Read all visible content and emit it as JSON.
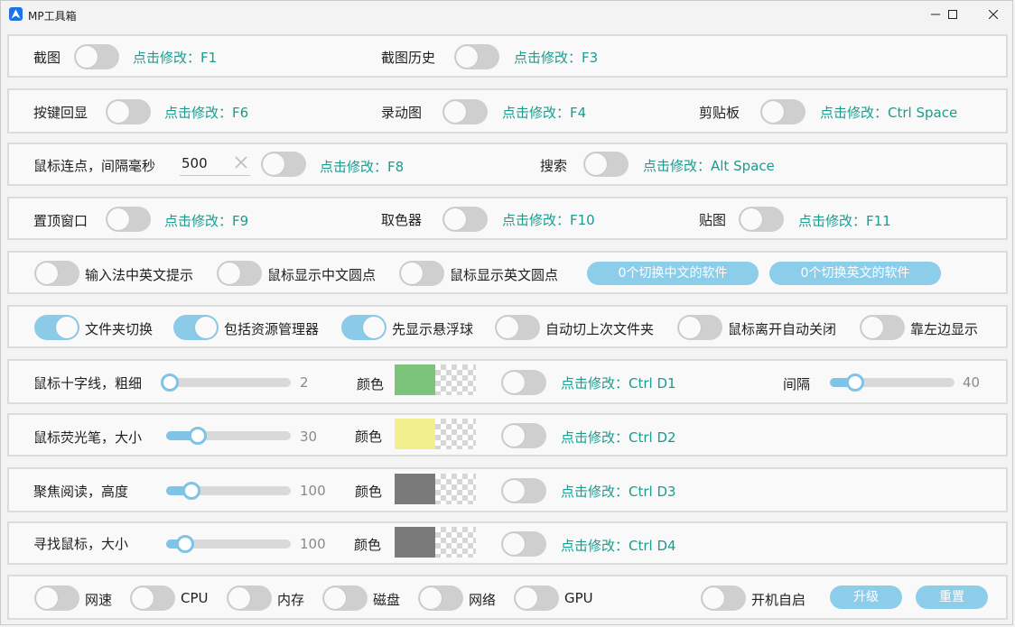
{
  "window": {
    "title": "MP工具箱"
  },
  "row1": {
    "screenshot": "截图",
    "screenshot_key": "点击修改：F1",
    "history": "截图历史",
    "history_key": "点击修改：F3"
  },
  "row2": {
    "keyecho": "按键回显",
    "keyecho_key": "点击修改：F6",
    "gif": "录动图",
    "gif_key": "点击修改：F4",
    "clipboard": "剪贴板",
    "clipboard_key": "点击修改：Ctrl Space"
  },
  "row3": {
    "autoclick": "鼠标连点，间隔毫秒",
    "interval": "500",
    "autoclick_key": "点击修改：F8",
    "search": "搜索",
    "search_key": "点击修改：Alt Space"
  },
  "row4": {
    "pin": "置顶窗口",
    "pin_key": "点击修改：F9",
    "picker": "取色器",
    "picker_key": "点击修改：F10",
    "paste": "贴图",
    "paste_key": "点击修改：F11"
  },
  "row5": {
    "ime_hint": "输入法中英文提示",
    "dot_cn": "鼠标显示中文圆点",
    "dot_en": "鼠标显示英文圆点",
    "cn_apps": "0个切换中文的软件",
    "en_apps": "0个切换英文的软件"
  },
  "row6": {
    "folder_switch": "文件夹切换",
    "explorer": "包括资源管理器",
    "float_ball": "先显示悬浮球",
    "last_folder": "自动切上次文件夹",
    "auto_close": "鼠标离开自动关闭",
    "left_side": "靠左边显示"
  },
  "crosshair": {
    "label": "鼠标十字线，粗细",
    "value": "2",
    "level": 0.0,
    "color_label": "颜色",
    "color": "#7cc47c",
    "key": "点击修改：Ctrl D1",
    "gap_label": "间隔",
    "gap_value": "40",
    "gap_level": 0.2
  },
  "highlighter": {
    "label": "鼠标荧光笔，大小",
    "value": "30",
    "level": 0.25,
    "color_label": "颜色",
    "color": "#f2f08e",
    "key": "点击修改：Ctrl D2"
  },
  "focus": {
    "label": "聚焦阅读，高度",
    "value": "100",
    "level": 0.2,
    "color_label": "颜色",
    "color": "#7a7a7a",
    "key": "点击修改：Ctrl D3"
  },
  "find": {
    "label": "寻找鼠标，大小",
    "value": "100",
    "level": 0.15,
    "color_label": "颜色",
    "color": "#7a7a7a",
    "key": "点击修改：Ctrl D4"
  },
  "bottom": {
    "net_speed": "网速",
    "cpu": "CPU",
    "memory": "内存",
    "disk": "磁盘",
    "network": "网络",
    "gpu": "GPU",
    "autostart": "开机自启",
    "upgrade": "升级",
    "reset": "重置"
  }
}
